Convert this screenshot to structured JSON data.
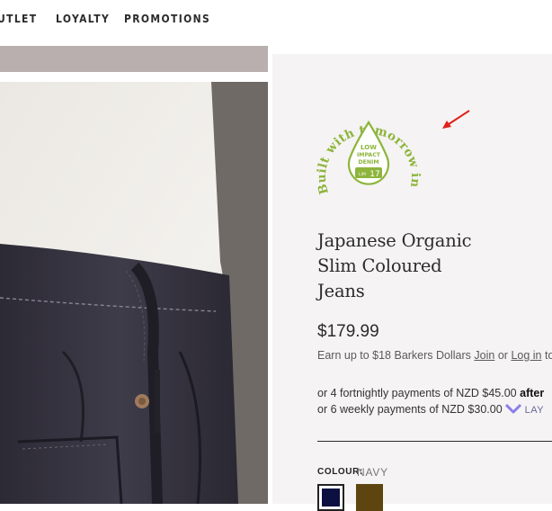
{
  "nav": {
    "items": [
      "UTLET",
      "LOYALTY",
      "PROMOTIONS"
    ]
  },
  "badge": {
    "arc_text": "Built with tomorrow in mind",
    "line1": "LOW",
    "line2": "IMPACT",
    "line3": "DENIM",
    "score_prefix": "LIM",
    "score": "17",
    "color": "#8db53c"
  },
  "product": {
    "title_lines": [
      "Japanese Organic",
      "Slim Coloured",
      "Jeans"
    ],
    "price": "$179.99",
    "earn_text": "Earn up to $18 Barkers Dollars",
    "join_label": "Join",
    "or_label": "or",
    "login_label": "Log in",
    "trailing": "to",
    "afterpay_text": "or 4 fortnightly payments of NZD $45.00",
    "afterpay_brand": "after",
    "laybuy_text": "or 6 weekly payments of NZD $30.00",
    "laybuy_brand": "LAY"
  },
  "colour": {
    "label": "COLOUR:",
    "value": "NAVY",
    "swatches": [
      {
        "name": "navy",
        "color": "#0b1040",
        "selected": true
      },
      {
        "name": "brown",
        "color": "#5e4510",
        "selected": false
      }
    ]
  }
}
